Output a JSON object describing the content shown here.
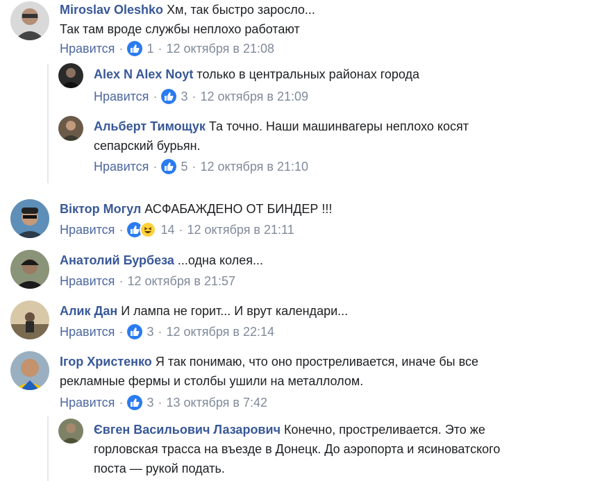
{
  "comments": [
    {
      "author": "Miroslav Oleshko",
      "text_line1": "Хм, так быстро заросло...",
      "text_line2": "Так там вроде службы неплохо работают",
      "like": "Нравится",
      "count": "1",
      "time": "12 октября в 21:08"
    },
    {
      "author": "Alex N Alex Noyt",
      "text_line1": "только в центральных районах города",
      "like": "Нравится",
      "count": "3",
      "time": "12 октября в 21:09"
    },
    {
      "author": "Альберт Тимощук",
      "text_line1": "Та точно. Наши машинвагеры неплохо косят",
      "text_line2": "сепарский бурьян.",
      "like": "Нравится",
      "count": "5",
      "time": "12 октября в 21:10"
    },
    {
      "author": "Віктор Могул",
      "text_line1": "АСФАБАЖДЕНО ОТ БИНДЕР !!!",
      "like": "Нравится",
      "count": "14",
      "time": "12 октября в 21:11"
    },
    {
      "author": "Анатолий Бурбеза",
      "text_line1": "...одна колея...",
      "like": "Нравится",
      "time": "12 октября в 21:57"
    },
    {
      "author": "Алик Дан",
      "text_line1": "И лампа не горит... И врут календари...",
      "like": "Нравится",
      "count": "3",
      "time": "12 октября в 22:14"
    },
    {
      "author": "Ігор Христенко",
      "text_line1": "Я так понимаю, что оно простреливается, иначе бы все",
      "text_line2": "рекламные фермы и столбы ушили на металлолом.",
      "like": "Нравится",
      "count": "3",
      "time": "13 октября в 7:42"
    },
    {
      "author": "Євген Васильович Лазарович",
      "text_line1": "Конечно, простреливается. Это же",
      "text_line2": "горловская трасса на въезде в Донецк. До аэропорта и ясиноватского",
      "text_line3": "поста — рукой подать."
    }
  ],
  "colors": {
    "author": "#385898",
    "like_reaction": "#2b7bf0",
    "haha_reaction": "#ffd23c",
    "meta": "#7f8a9a"
  }
}
